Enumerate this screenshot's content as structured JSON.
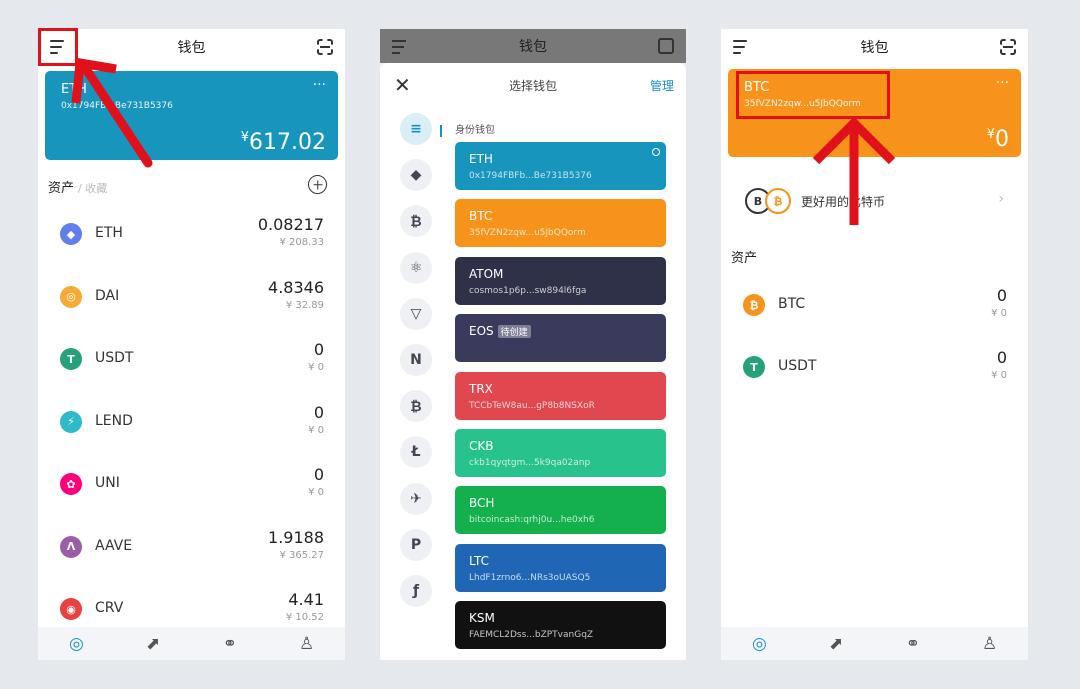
{
  "phone1": {
    "title": "钱包",
    "card": {
      "name": "ETH",
      "address": "0x1794FB...Be731B5376",
      "currency": "¥",
      "balance": "617.02",
      "more": "···"
    },
    "assets_label": "资产",
    "collect_label": "/ 收藏",
    "assets": [
      {
        "symbol": "ETH",
        "amount": "0.08217",
        "cny": "¥ 208.33",
        "icon": "eth-icon",
        "color": "#627eea",
        "glyph": "◆"
      },
      {
        "symbol": "DAI",
        "amount": "4.8346",
        "cny": "¥ 32.89",
        "icon": "dai-icon",
        "color": "#f5ac37",
        "glyph": "◎"
      },
      {
        "symbol": "USDT",
        "amount": "0",
        "cny": "¥ 0",
        "icon": "usdt-icon",
        "color": "#26a17b",
        "glyph": "T"
      },
      {
        "symbol": "LEND",
        "amount": "0",
        "cny": "¥ 0",
        "icon": "lend-icon",
        "color": "#2ebac6",
        "glyph": "⚡"
      },
      {
        "symbol": "UNI",
        "amount": "0",
        "cny": "¥ 0",
        "icon": "uni-icon",
        "color": "#ff007a",
        "glyph": "✿"
      },
      {
        "symbol": "AAVE",
        "amount": "1.9188",
        "cny": "¥ 365.27",
        "icon": "aave-icon",
        "color": "#9b5ca8",
        "glyph": "Λ"
      },
      {
        "symbol": "CRV",
        "amount": "4.41",
        "cny": "¥ 10.52",
        "icon": "crv-icon",
        "color": "#e84142",
        "glyph": "◉"
      }
    ]
  },
  "phone2": {
    "title": "钱包",
    "sheet_title": "选择钱包",
    "manage": "管理",
    "close": "✕",
    "identity_label": "身份钱包",
    "side_icons": [
      "≡",
      "◆",
      "₿",
      "⚛",
      "▽",
      "N",
      "₿",
      "Ł",
      "✈",
      "P",
      "ƒ"
    ],
    "wallets": [
      {
        "name": "ETH",
        "address": "0x1794FBFb...Be731B5376",
        "color": "#1795bd",
        "badge": ""
      },
      {
        "name": "BTC",
        "address": "35fVZN2zqw...u5JbQQorm",
        "color": "#f7931a",
        "badge": ""
      },
      {
        "name": "ATOM",
        "address": "cosmos1p6p...sw894l6fga",
        "color": "#2e3148",
        "badge": ""
      },
      {
        "name": "EOS",
        "address": "",
        "color": "#3a3a5c",
        "badge": "待创建"
      },
      {
        "name": "TRX",
        "address": "TCCbTeW8au...gP8b8NSXoR",
        "color": "#e0474f",
        "badge": ""
      },
      {
        "name": "CKB",
        "address": "ckb1qyqtgm...5k9qa02anp",
        "color": "#28c28c",
        "badge": ""
      },
      {
        "name": "BCH",
        "address": "bitcoincash:qrhj0u...he0xh6",
        "color": "#13b04d",
        "badge": ""
      },
      {
        "name": "LTC",
        "address": "LhdF1zrno6...NRs3oUASQ5",
        "color": "#1f66b5",
        "badge": ""
      },
      {
        "name": "KSM",
        "address": "FAEMCL2Dss...bZPTvanGqZ",
        "color": "#111111",
        "badge": ""
      }
    ]
  },
  "phone3": {
    "title": "钱包",
    "card": {
      "name": "BTC",
      "address": "35fVZN2zqw...u5JbQQorm",
      "currency": "¥",
      "balance": "0",
      "more": "···"
    },
    "promo": "更好用的比特币",
    "assets_label": "资产",
    "assets": [
      {
        "symbol": "BTC",
        "amount": "0",
        "cny": "¥ 0",
        "icon": "btc-icon",
        "color": "#f7931a",
        "glyph": "₿"
      },
      {
        "symbol": "USDT",
        "amount": "0",
        "cny": "¥ 0",
        "icon": "usdt-icon",
        "color": "#26a17b",
        "glyph": "T"
      }
    ]
  },
  "nav_icons": [
    "◎",
    "⬈",
    "⚭",
    "♙"
  ]
}
